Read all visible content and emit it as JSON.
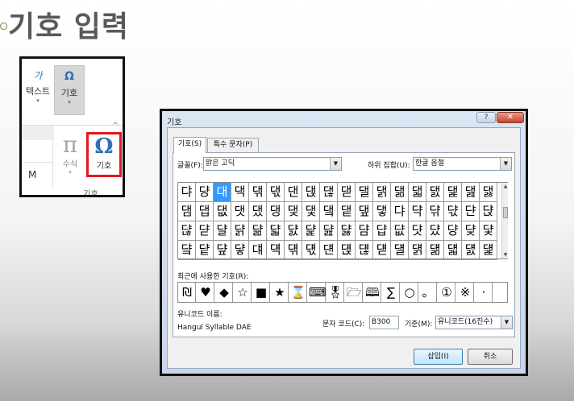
{
  "slide": {
    "title": "기호 입력"
  },
  "ribbon": {
    "text_icon": "가",
    "text_label": "텍스트",
    "symbol_icon": "Ω",
    "symbol_label": "기호",
    "equation_icon": "π",
    "equation_label": "수식",
    "omega_icon": "Ω",
    "omega_label": "기호",
    "group_label": "기호",
    "left_cell_text": "M",
    "dropdown_glyph": "▾",
    "collapse_glyph": "^"
  },
  "dialog": {
    "title": "기호",
    "help_btn": "?",
    "close_btn": "✕",
    "tabs": [
      {
        "label": "기호(S)",
        "active": true
      },
      {
        "label": "특수 문자(P)",
        "active": false
      }
    ],
    "font_label": "글꼴(F):",
    "font_value": "맑은 고딕",
    "subset_label": "하위 집합(U):",
    "subset_value": "한글 음절",
    "dropdown_glyph": "▼",
    "grid_rows": [
      [
        "댜",
        "댱",
        "대",
        "댁",
        "댂",
        "댃",
        "댄",
        "댅",
        "댆",
        "댇",
        "댈",
        "댉",
        "댊",
        "댋",
        "댌",
        "댍",
        "댎",
        "댏"
      ],
      [
        "댐",
        "댑",
        "댒",
        "댓",
        "댔",
        "댕",
        "댖",
        "댗",
        "댘",
        "댙",
        "댚",
        "댛",
        "댜",
        "댝",
        "댞",
        "댟",
        "댠",
        "댡"
      ],
      [
        "댢",
        "댣",
        "댤",
        "댥",
        "댦",
        "댧",
        "댨",
        "댩",
        "댪",
        "댫",
        "댬",
        "댭",
        "댮",
        "댯",
        "댰",
        "댱",
        "댲",
        "댳"
      ],
      [
        "댴",
        "댵",
        "댶",
        "댷",
        "댸",
        "댹",
        "댺",
        "댻",
        "댼",
        "댽",
        "댾",
        "댿",
        "덀",
        "덁",
        "덂",
        "덃",
        "덄",
        "덅"
      ]
    ],
    "selected_cell": [
      0,
      2
    ],
    "recent_label": "최근에 사용한 기호(R):",
    "recent_symbols": [
      "₪",
      "♥",
      "◆",
      "☆",
      "■",
      "★",
      "⌛",
      "⌨",
      "🎖",
      "🗁",
      "🕮",
      "∑",
      "○",
      "。",
      "①",
      "※",
      "·"
    ],
    "unicode_name_label": "유니코드 이름:",
    "unicode_name_value": "Hangul Syllable DAE",
    "charcode_label": "문자 코드(C):",
    "charcode_value": "B300",
    "from_label": "기준(M):",
    "from_value": "유니코드(16진수)",
    "insert_btn": "삽입(I)",
    "cancel_btn": "취소",
    "scroll_up": "▲",
    "scroll_down": "▼"
  }
}
